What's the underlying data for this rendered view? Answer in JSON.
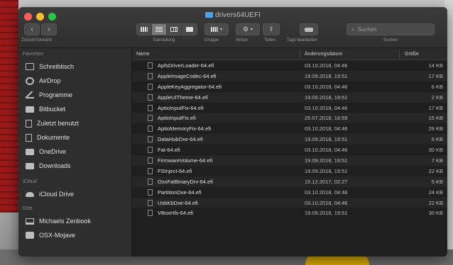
{
  "window": {
    "title": "drivers64UEFI"
  },
  "toolbar": {
    "nav_label": "Zurück/Vorwärts",
    "view_label": "Darstellung",
    "group_label": "Gruppe",
    "action_label": "Aktion",
    "share_label": "Teilen",
    "tags_label": "Tags bearbeiten",
    "search_label": "Suchen",
    "search_placeholder": "Suchen"
  },
  "sidebar": {
    "favorites_header": "Favoriten",
    "favorites": [
      {
        "label": "Schreibtisch",
        "icon": "desktop-icon"
      },
      {
        "label": "AirDrop",
        "icon": "airdrop-icon"
      },
      {
        "label": "Programme",
        "icon": "applications-icon"
      },
      {
        "label": "Bitbucket",
        "icon": "folder-icon"
      },
      {
        "label": "Zuletzt benutzt",
        "icon": "document-icon"
      },
      {
        "label": "Dokumente",
        "icon": "document-icon"
      },
      {
        "label": "OneDrive",
        "icon": "folder-icon"
      },
      {
        "label": "Downloads",
        "icon": "folder-icon"
      }
    ],
    "icloud_header": "iCloud",
    "icloud": [
      {
        "label": "iCloud Drive",
        "icon": "cloud-icon"
      }
    ],
    "locations_header": "Orte",
    "locations": [
      {
        "label": "Michaels Zenbook",
        "icon": "laptop-icon"
      },
      {
        "label": "OSX-Mojave",
        "icon": "disk-icon"
      }
    ]
  },
  "columns": {
    "name": "Name",
    "date": "Änderungsdatum",
    "size": "Größe"
  },
  "files": [
    {
      "name": "ApfsDriverLoader-64.efi",
      "date": "03.10.2018, 04:46",
      "size": "14 KB"
    },
    {
      "name": "AppleImageCodec-64.efi",
      "date": "19.09.2018, 19:51",
      "size": "17 KB"
    },
    {
      "name": "AppleKeyAggregator-64.efi",
      "date": "03.10.2018, 04:46",
      "size": "6 KB"
    },
    {
      "name": "AppleUITheme-64.efi",
      "date": "19.09.2018, 19:51",
      "size": "2 KB"
    },
    {
      "name": "AptioInputFix-64.efi",
      "date": "03.10.2018, 04:46",
      "size": "17 KB"
    },
    {
      "name": "AptioInputFix.efi",
      "date": "25.07.2018, 18:59",
      "size": "15 KB"
    },
    {
      "name": "AptioMemoryFix-64.efi",
      "date": "03.10.2018, 04:46",
      "size": "29 KB"
    },
    {
      "name": "DataHubDxe-64.efi",
      "date": "19.09.2018, 19:51",
      "size": "6 KB"
    },
    {
      "name": "Fat-64.efi",
      "date": "03.10.2018, 04:46",
      "size": "30 KB"
    },
    {
      "name": "FirmwareVolume-64.efi",
      "date": "19.09.2018, 19:51",
      "size": "7 KB"
    },
    {
      "name": "FSInject-64.efi",
      "date": "19.09.2018, 19:51",
      "size": "22 KB"
    },
    {
      "name": "OsxFatBinaryDrv-64.efi",
      "date": "15.12.2017, 02:27",
      "size": "5 KB"
    },
    {
      "name": "PartitionDxe-64.efi",
      "date": "03.10.2018, 04:46",
      "size": "24 KB"
    },
    {
      "name": "UsbKbDxe-64.efi",
      "date": "03.10.2018, 04:46",
      "size": "22 KB"
    },
    {
      "name": "VBoxHfs-64.efi",
      "date": "19.09.2018, 19:51",
      "size": "30 KB"
    }
  ]
}
